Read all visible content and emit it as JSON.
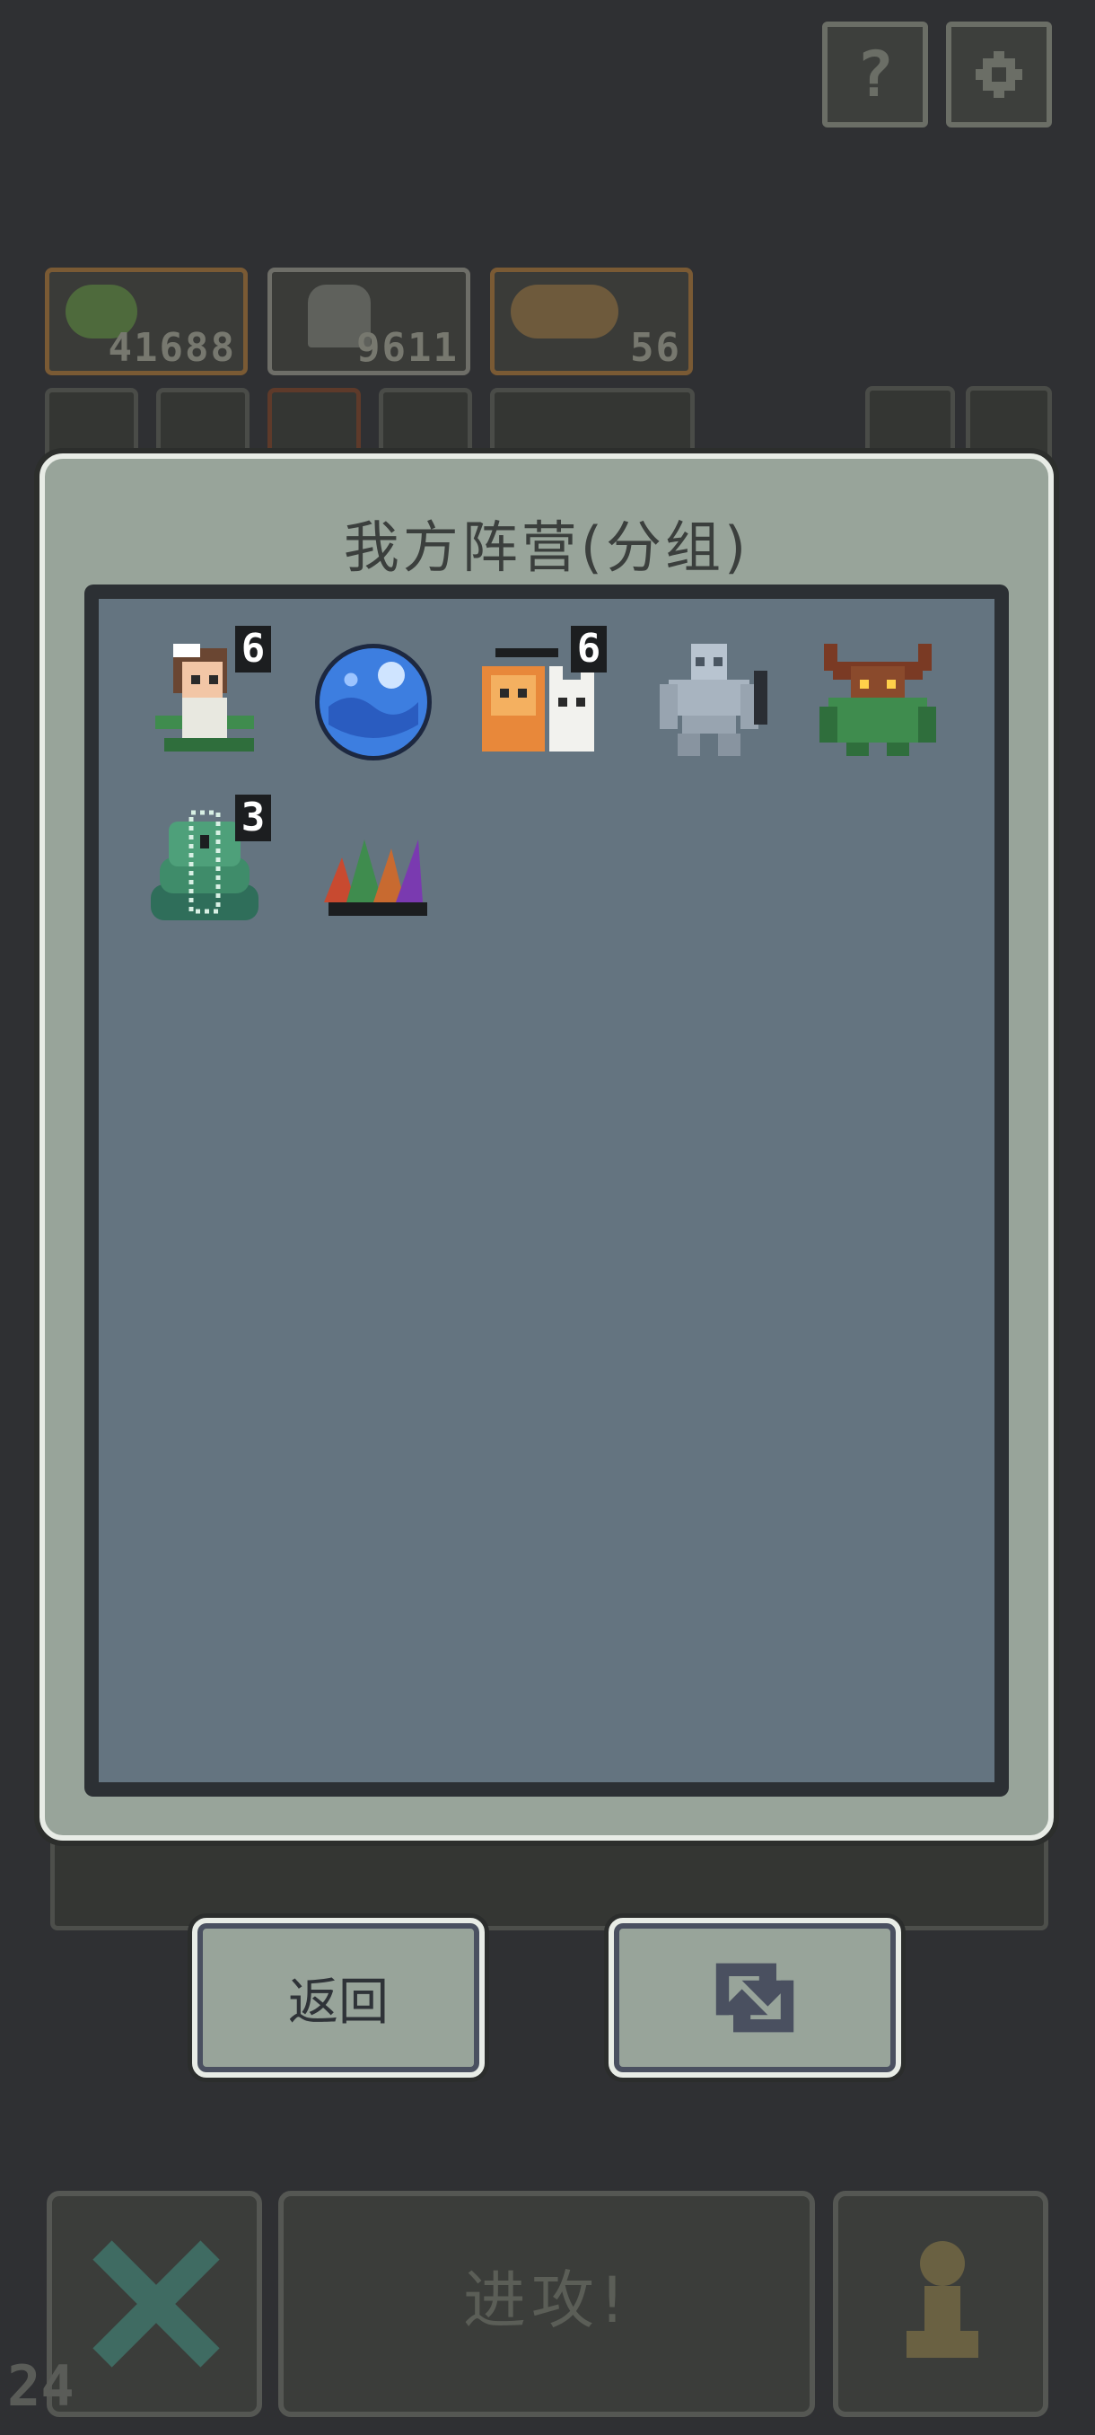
{
  "top_buttons": {
    "help_glyph": "?",
    "settings_icon": "gear-icon"
  },
  "resources": [
    {
      "icon": "slime-icon",
      "value": "41688"
    },
    {
      "icon": "tombstone-icon",
      "value": "9611"
    },
    {
      "icon": "lion-and-wolf-icon",
      "value": "56"
    }
  ],
  "modal": {
    "title": "我方阵营(分组)",
    "units": [
      {
        "name": "girl-with-snakes",
        "count": "6"
      },
      {
        "name": "water-orb",
        "count": ""
      },
      {
        "name": "lion-and-wolf",
        "count": "6"
      },
      {
        "name": "stone-golem",
        "count": ""
      },
      {
        "name": "minotaur",
        "count": ""
      },
      {
        "name": "green-serpent",
        "count": "3"
      },
      {
        "name": "crystal-plant",
        "count": ""
      }
    ]
  },
  "buttons": {
    "back_label": "返回",
    "swap_icon": "swap-icon"
  },
  "bottom": {
    "attack_label": "进攻!",
    "close_icon": "x-icon",
    "pawn_icon": "pawn-icon"
  },
  "fps": "24",
  "colors": {
    "panel": "#98a49a",
    "inner": "#647480",
    "border_light": "#e8ece6",
    "bg": "#2f3033"
  }
}
